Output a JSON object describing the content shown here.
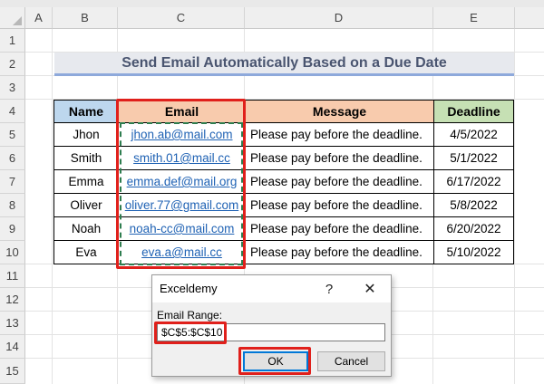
{
  "columns": [
    "A",
    "B",
    "C",
    "D",
    "E"
  ],
  "rows": [
    "1",
    "2",
    "3",
    "4",
    "5",
    "6",
    "7",
    "8",
    "9",
    "10",
    "11",
    "12",
    "13",
    "14",
    "15"
  ],
  "title": "Send Email Automatically Based on a Due Date",
  "table": {
    "headers": {
      "name": "Name",
      "email": "Email",
      "message": "Message",
      "deadline": "Deadline"
    },
    "rows": [
      {
        "name": "Jhon",
        "email": "jhon.ab@mail.com",
        "message": "Please pay before the deadline.",
        "deadline": "4/5/2022"
      },
      {
        "name": "Smith",
        "email": "smith.01@mail.cc",
        "message": "Please pay before the deadline.",
        "deadline": "5/1/2022"
      },
      {
        "name": "Emma",
        "email": "emma.def@mail.org",
        "message": "Please pay before the deadline.",
        "deadline": "6/17/2022"
      },
      {
        "name": "Oliver",
        "email": "oliver.77@gmail.com",
        "message": "Please pay before the deadline.",
        "deadline": "5/8/2022"
      },
      {
        "name": "Noah",
        "email": "noah-cc@mail.com",
        "message": "Please pay before the deadline.",
        "deadline": "6/20/2022"
      },
      {
        "name": "Eva",
        "email": "eva.a@mail.cc",
        "message": "Please pay before the deadline.",
        "deadline": "5/10/2022"
      }
    ]
  },
  "dialog": {
    "title": "Exceldemy",
    "help_icon": "?",
    "close_icon": "✕",
    "label": "Email Range:",
    "input_value": "$C$5:$C$10",
    "ok_label": "OK",
    "cancel_label": "Cancel"
  },
  "colors": {
    "highlight_border": "#e0201b",
    "selection_marquee": "#2e7d4f",
    "header_name": "#bdd7ee",
    "header_email_message": "#f8cbad",
    "header_deadline": "#c6e0b4",
    "hyperlink": "#1f62b4"
  }
}
